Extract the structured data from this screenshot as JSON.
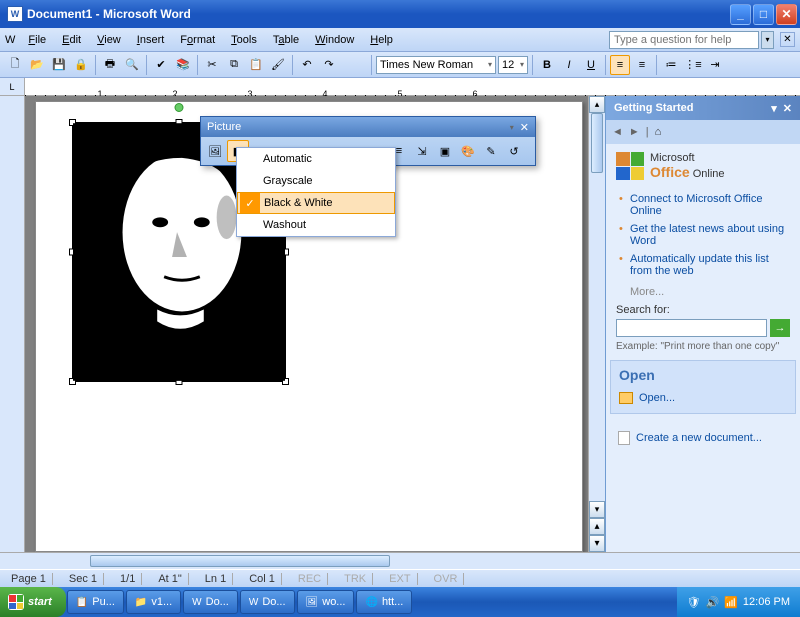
{
  "window": {
    "title": "Document1 - Microsoft Word"
  },
  "menu": {
    "file": "File",
    "edit": "Edit",
    "view": "View",
    "insert": "Insert",
    "format": "Format",
    "tools": "Tools",
    "table": "Table",
    "window": "Window",
    "help": "Help",
    "helpPlaceholder": "Type a question for help"
  },
  "formatting": {
    "font": "Times New Roman",
    "size": "12"
  },
  "ruler": {
    "n1": "1",
    "n2": "2",
    "n3": "3",
    "n4": "4",
    "n5": "5",
    "n6": "6"
  },
  "picToolbar": {
    "title": "Picture"
  },
  "colorMenu": {
    "auto": "Automatic",
    "gray": "Grayscale",
    "bw": "Black & White",
    "wash": "Washout"
  },
  "taskpane": {
    "title": "Getting Started",
    "office_small": "Microsoft",
    "office_brand": "Office",
    "office_online": "Online",
    "link1": "Connect to Microsoft Office Online",
    "link2": "Get the latest news about using Word",
    "link3": "Automatically update this list from the web",
    "more": "More...",
    "searchLabel": "Search for:",
    "example": "Example:  \"Print more than one copy\"",
    "openTitle": "Open",
    "openLink": "Open...",
    "newDoc": "Create a new document..."
  },
  "status": {
    "page": "Page 1",
    "sec": "Sec 1",
    "pages": "1/1",
    "at": "At 1\"",
    "ln": "Ln 1",
    "col": "Col 1",
    "rec": "REC",
    "trk": "TRK",
    "ext": "EXT",
    "ovr": "OVR"
  },
  "taskbar": {
    "start": "start",
    "b1": "Pu...",
    "b2": "v1...",
    "b3": "Do...",
    "b4": "Do...",
    "b5": "wo...",
    "b6": "htt...",
    "time": "12:06 PM"
  }
}
